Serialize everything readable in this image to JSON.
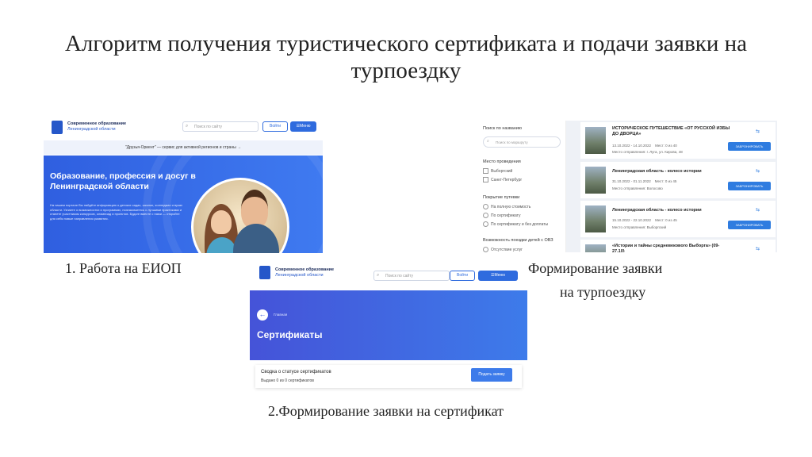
{
  "slide": {
    "title": "Алгоритм получения туристического сертификата и подачи заявки на турпоездку",
    "caption1": "1.  Работа на ЕИОП",
    "caption2_line1": "Формирование заявки",
    "caption2_line2": "на турпоездку",
    "caption3": "2.Формирование заявки на сертификат"
  },
  "portal": {
    "logo_line1": "Современное образование",
    "logo_line2": "Ленинградской области",
    "search_placeholder": "Поиск по сайту",
    "login": "Войти",
    "menu": "☰Меню"
  },
  "shot1": {
    "banner": "\"Друзья-Ориент\" — сервис для активной регионов и страны →",
    "hero_title": "Образование, профессия и досуг в Ленинградской области",
    "hero_text": "На нашем портале Вы найдёте информацию о детских садах, школах, колледжах и вузах области. Узнаете о возможностях и программах, познакомитесь с лучшими практиками и станете участником конкурсов, олимпиад и проектов. Будьте вместе с нами — откройте для себя новые направления развития."
  },
  "shot2": {
    "filter_search_title": "Поиск по названию",
    "filter_search_placeholder": "Поиск по маршруту",
    "place_title": "Место проведения",
    "place_options": [
      "Выборгский",
      "Санкт-Петербург"
    ],
    "coverage_title": "Покрытие путевки",
    "coverage_options": [
      "На полную стоимость",
      "По сертификату",
      "По сертификату и без доплаты"
    ],
    "kids_title": "Возможность поездки детей с ОВЗ",
    "kids_option": "Отсутствие услуг",
    "tours": [
      {
        "title": "ИСТОРИЧЕСКОЕ ПУТЕШЕСТВИЕ «ОТ РУССКОЙ ИЗБЫ ДО ДВОРЦА»",
        "dates": "13.10.2022 - 14.10.2022",
        "seats": "Мест: 0 из 40",
        "place": "Место отправления: г. Луга, ул. Кирова, 48",
        "book": "ЗАБРОНИРОВАТЬ"
      },
      {
        "title": "Ленинградская область - колесо истории",
        "dates": "31.10.2022 - 01.11.2022",
        "seats": "Мест: 0 из 45",
        "place": "Место отправления: Волосово",
        "book": "ЗАБРОНИРОВАТЬ"
      },
      {
        "title": "Ленинградская область - колесо истории",
        "dates": "15.10.2022 - 22.10.2022",
        "seats": "Мест: 0 из 45",
        "place": "Место отправления: Выборгский",
        "book": "ЗАБРОНИРОВАТЬ"
      },
      {
        "title": "«Истории и тайны средневекового Выборга» (09-27.10)",
        "dates": "",
        "seats": "",
        "place": "",
        "book": ""
      }
    ]
  },
  "shot3": {
    "crumb": "Главная",
    "heading": "Сертификаты",
    "card_title": "Сводка о статусе сертификатов",
    "card_sub": "Выдано 0 из 0 сертификатов",
    "submit": "Подать заявку"
  }
}
